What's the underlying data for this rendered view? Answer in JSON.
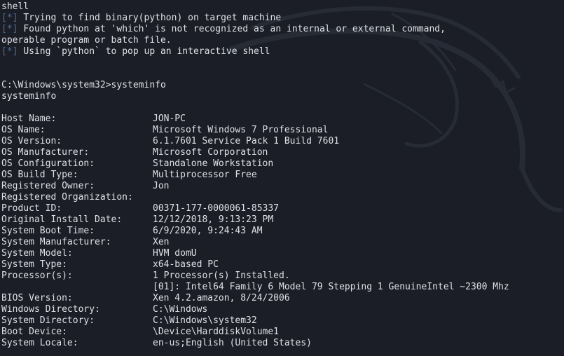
{
  "header": {
    "cmd": "shell",
    "marker": "[*]",
    "messages": [
      "Trying to find binary(python) on target machine",
      "Found python at 'which' is not recognized as an internal or external command,",
      "Using `python` to pop up an interactive shell"
    ],
    "continuation": "operable program or batch file."
  },
  "prompt": {
    "line": "C:\\Windows\\system32>systeminfo",
    "echo": "systeminfo"
  },
  "sysinfo": [
    {
      "key": "Host Name:",
      "value": "JON-PC"
    },
    {
      "key": "OS Name:",
      "value": "Microsoft Windows 7 Professional"
    },
    {
      "key": "OS Version:",
      "value": "6.1.7601 Service Pack 1 Build 7601"
    },
    {
      "key": "OS Manufacturer:",
      "value": "Microsoft Corporation"
    },
    {
      "key": "OS Configuration:",
      "value": "Standalone Workstation"
    },
    {
      "key": "OS Build Type:",
      "value": "Multiprocessor Free"
    },
    {
      "key": "Registered Owner:",
      "value": "Jon"
    },
    {
      "key": "Registered Organization:",
      "value": ""
    },
    {
      "key": "Product ID:",
      "value": "00371-177-0000061-85337"
    },
    {
      "key": "Original Install Date:",
      "value": "12/12/2018, 9:13:23 PM"
    },
    {
      "key": "System Boot Time:",
      "value": "6/9/2020, 9:24:43 AM"
    },
    {
      "key": "System Manufacturer:",
      "value": "Xen"
    },
    {
      "key": "System Model:",
      "value": "HVM domU"
    },
    {
      "key": "System Type:",
      "value": "x64-based PC"
    },
    {
      "key": "Processor(s):",
      "value": "1 Processor(s) Installed."
    }
  ],
  "processor_detail": "[01]: Intel64 Family 6 Model 79 Stepping 1 GenuineIntel ~2300 Mhz",
  "sysinfo_tail": [
    {
      "key": "BIOS Version:",
      "value": "Xen 4.2.amazon, 8/24/2006"
    },
    {
      "key": "Windows Directory:",
      "value": "C:\\Windows"
    },
    {
      "key": "System Directory:",
      "value": "C:\\Windows\\system32"
    },
    {
      "key": "Boot Device:",
      "value": "\\Device\\HarddiskVolume1"
    },
    {
      "key": "System Locale:",
      "value": "en-us;English (United States)"
    }
  ],
  "colors": {
    "background": "#1b1e26",
    "text": "#dde0e6",
    "marker": "#4a6e9e"
  }
}
